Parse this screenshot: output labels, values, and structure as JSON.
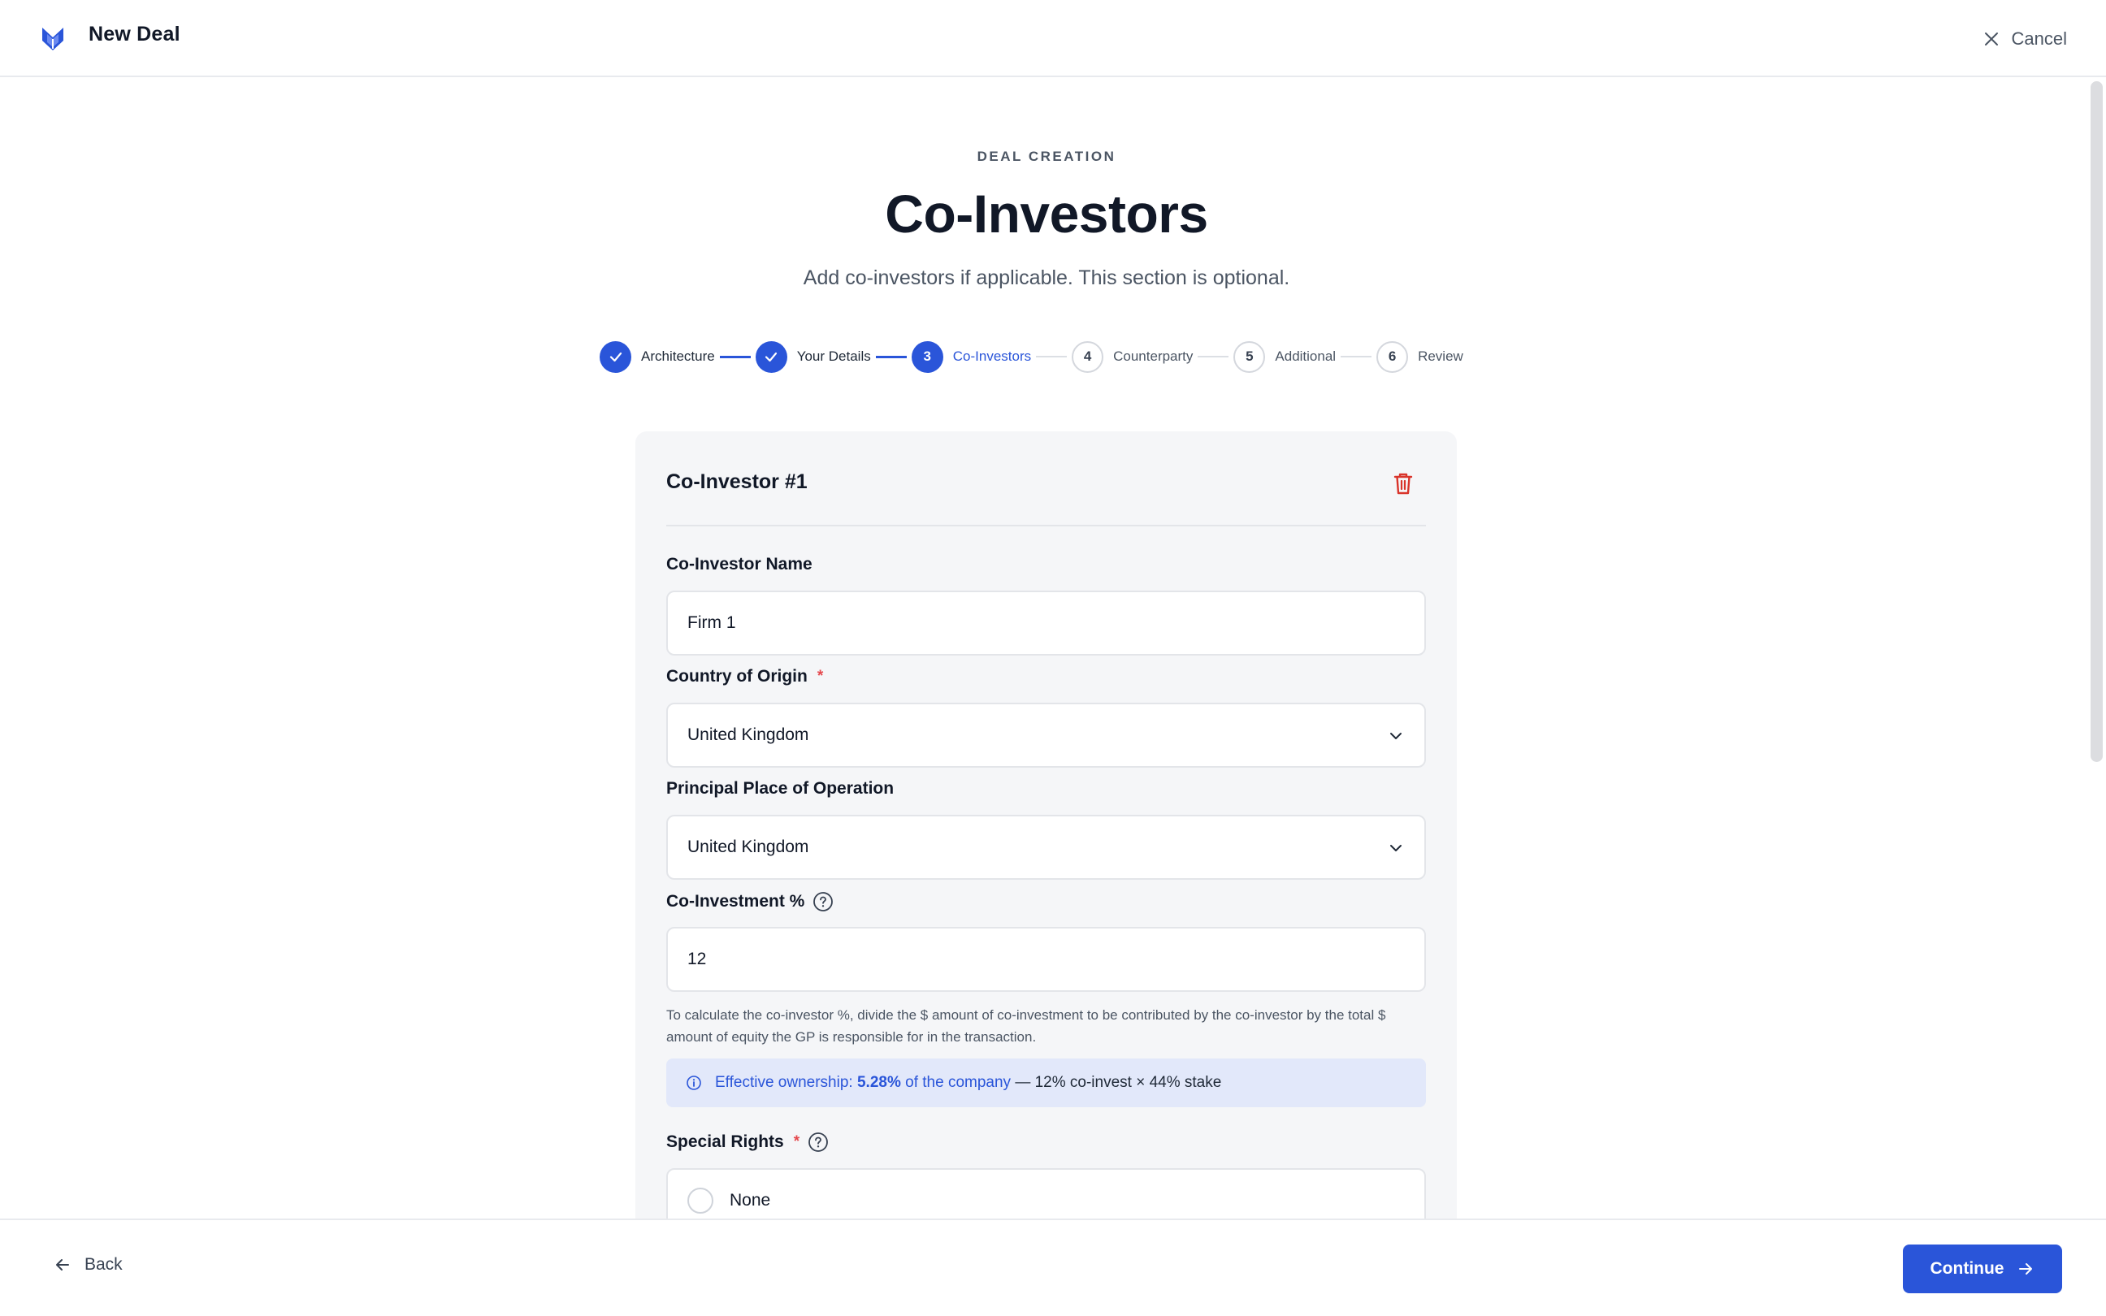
{
  "header": {
    "app_title": "New Deal",
    "cancel_label": "Cancel"
  },
  "page": {
    "eyebrow": "DEAL CREATION",
    "title": "Co-Investors",
    "subtitle": "Add co-investors if applicable. This section is optional."
  },
  "stepper": {
    "steps": [
      {
        "number": "1",
        "label": "Architecture",
        "state": "done"
      },
      {
        "number": "2",
        "label": "Your Details",
        "state": "done"
      },
      {
        "number": "3",
        "label": "Co-Investors",
        "state": "active"
      },
      {
        "number": "4",
        "label": "Counterparty",
        "state": "todo"
      },
      {
        "number": "5",
        "label": "Additional",
        "state": "todo"
      },
      {
        "number": "6",
        "label": "Review",
        "state": "todo"
      }
    ]
  },
  "card": {
    "title": "Co-Investor #1",
    "name_label": "Co-Investor Name",
    "name_value": "Firm 1",
    "country_label": "Country of Origin",
    "country_value": "United Kingdom",
    "operation_label": "Principal Place of Operation",
    "operation_value": "United Kingdom",
    "coinvest_label": "Co-Investment %",
    "coinvest_value": "12",
    "help_text": "To calculate the co-investor %, divide the $ amount of co-investment to be contributed by the co-investor by the total $ amount of equity the GP is responsible for in the transaction.",
    "info_prefix": "Effective ownership:",
    "info_value": "5.28%",
    "info_middle": "of the company",
    "info_suffix": "— 12% co-invest × 44% stake",
    "special_rights_label": "Special Rights",
    "special_rights_option": "None",
    "required_mark": "*"
  },
  "footer": {
    "back_label": "Back",
    "continue_label": "Continue"
  },
  "colors": {
    "accent": "#2a55d9",
    "danger": "#d9342b",
    "info_bg": "#e2e8fa"
  }
}
